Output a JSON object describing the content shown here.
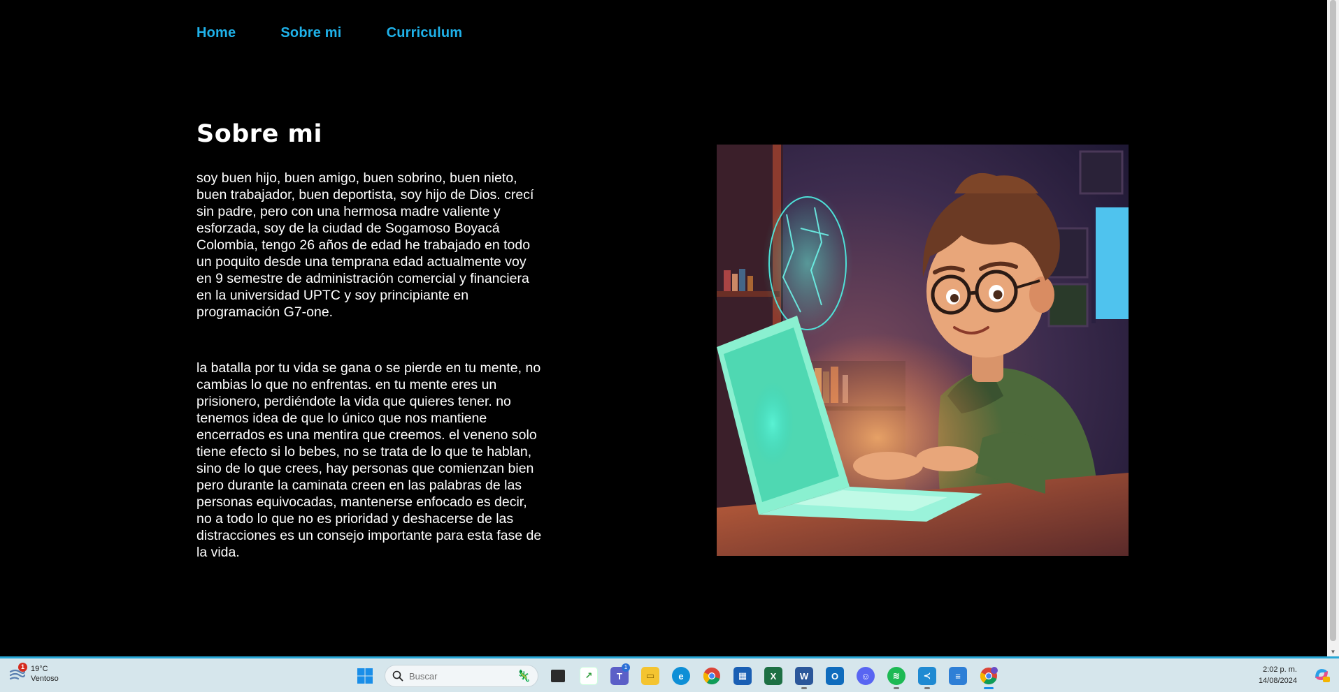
{
  "nav": {
    "items": [
      "Home",
      "Sobre mi",
      "Curriculum"
    ]
  },
  "content": {
    "title": "Sobre mi",
    "paragraphs": [
      "soy buen hijo, buen amigo, buen sobrino, buen nieto, buen trabajador, buen deportista, soy hijo de Dios. crecí sin padre, pero con una hermosa madre valiente y esforzada, soy de la ciudad de Sogamoso Boyacá Colombia, tengo 26 años de edad he trabajado en todo un poquito desde una temprana edad actualmente voy en 9 semestre de administración comercial y financiera en la universidad UPTC y soy principiante en programación G7-one.",
      "la batalla por tu vida se gana o se pierde en tu mente, no cambias lo que no enfrentas. en tu mente eres un prisionero, perdiéndote la vida que quieres tener. no tenemos idea de que lo único que nos mantiene encerrados es una mentira que creemos. el veneno solo tiene efecto si lo bebes, no se trata de lo que te hablan, sino de lo que crees, hay personas que comienzan bien pero durante la caminata creen en las palabras de las personas equivocadas, mantenerse enfocado es decir, no a todo lo que no es prioridad y deshacerse de las distracciones es un consejo importante para esta fase de la vida."
    ],
    "illustration": "illustration-boy-with-laptop"
  },
  "colors": {
    "background": "#000000",
    "nav_link": "#1fb2ea",
    "text": "#ffffff",
    "taskbar": "#d6e6ec",
    "taskbar_accent": "#27a7d6"
  },
  "taskbar": {
    "weather": {
      "temp": "19°C",
      "condition": "Ventoso",
      "badge": "1",
      "icon": "weather-icon"
    },
    "search_placeholder": "Buscar",
    "apps": [
      {
        "name": "windows-start-icon"
      },
      {
        "name": "task-view-icon"
      },
      {
        "name": "stock-app-icon"
      },
      {
        "name": "teams-icon",
        "badge": "1"
      },
      {
        "name": "file-explorer-icon"
      },
      {
        "name": "edge-icon"
      },
      {
        "name": "chrome-icon"
      },
      {
        "name": "store-icon"
      },
      {
        "name": "excel-icon"
      },
      {
        "name": "word-icon"
      },
      {
        "name": "outlook-icon"
      },
      {
        "name": "discord-icon"
      },
      {
        "name": "spotify-icon"
      },
      {
        "name": "vscode-icon"
      },
      {
        "name": "notepad-icon"
      },
      {
        "name": "chrome-profile-icon"
      }
    ],
    "clock": {
      "time": "2:02 p. m.",
      "date": "14/08/2024"
    }
  }
}
